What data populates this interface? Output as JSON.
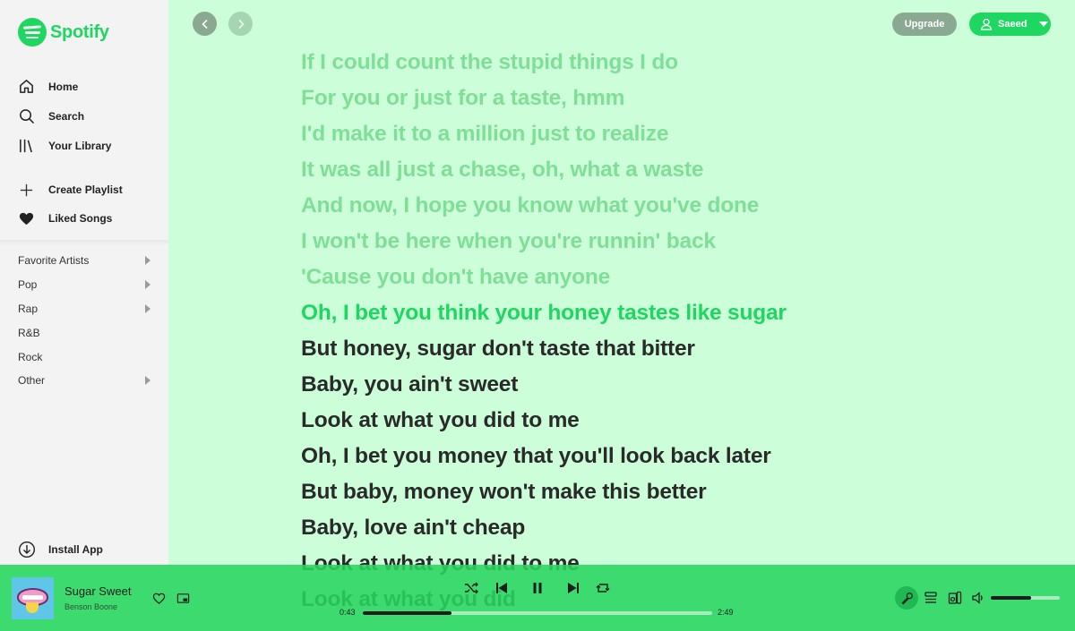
{
  "app": {
    "name": "Spotify"
  },
  "nav": [
    {
      "label": "Home",
      "icon": "home-icon"
    },
    {
      "label": "Search",
      "icon": "search-icon"
    },
    {
      "label": "Your Library",
      "icon": "library-icon"
    }
  ],
  "actions": [
    {
      "label": "Create Playlist",
      "icon": "plus-icon"
    },
    {
      "label": "Liked Songs",
      "icon": "heart-icon"
    }
  ],
  "playlists": [
    {
      "label": "Favorite Artists",
      "has_submenu": true
    },
    {
      "label": "Pop",
      "has_submenu": true
    },
    {
      "label": "Rap",
      "has_submenu": true
    },
    {
      "label": "R&B",
      "has_submenu": false
    },
    {
      "label": "Rock",
      "has_submenu": false
    },
    {
      "label": "Other",
      "has_submenu": true
    }
  ],
  "install": {
    "label": "Install App"
  },
  "header": {
    "upgrade_label": "Upgrade",
    "user_name": "Saeed"
  },
  "lyrics": [
    {
      "text": "If I could count the stupid things I do",
      "state": "past"
    },
    {
      "text": "For you or just for a taste, hmm",
      "state": "past"
    },
    {
      "text": "I'd make it to a million just to realize",
      "state": "past"
    },
    {
      "text": "It was all just a chase, oh, what a waste",
      "state": "past"
    },
    {
      "text": "And now, I hope you know what you've done",
      "state": "past"
    },
    {
      "text": "I won't be here when you're runnin' back",
      "state": "past"
    },
    {
      "text": "'Cause you don't have anyone",
      "state": "past"
    },
    {
      "text": "Oh, I bet you think your honey tastes like sugar",
      "state": "current"
    },
    {
      "text": "But honey, sugar don't taste that bitter",
      "state": "future"
    },
    {
      "text": "Baby, you ain't sweet",
      "state": "future"
    },
    {
      "text": "Look at what you did to me",
      "state": "future"
    },
    {
      "text": "Oh, I bet you money that you'll look back later",
      "state": "future"
    },
    {
      "text": "But baby, money won't make this better",
      "state": "future"
    },
    {
      "text": "Baby, love ain't cheap",
      "state": "future"
    },
    {
      "text": "Look at what you did to me",
      "state": "future"
    },
    {
      "text": "Look at what you did",
      "state": "future"
    }
  ],
  "player": {
    "title": "Sugar Sweet",
    "artist": "Benson Boone",
    "elapsed": "0:43",
    "duration": "2:49",
    "progress": 0.254,
    "volume": 0.58
  },
  "colors": {
    "accent": "#1ed760",
    "background": "#ccffd9",
    "sidebar": "#f3f3f3"
  }
}
